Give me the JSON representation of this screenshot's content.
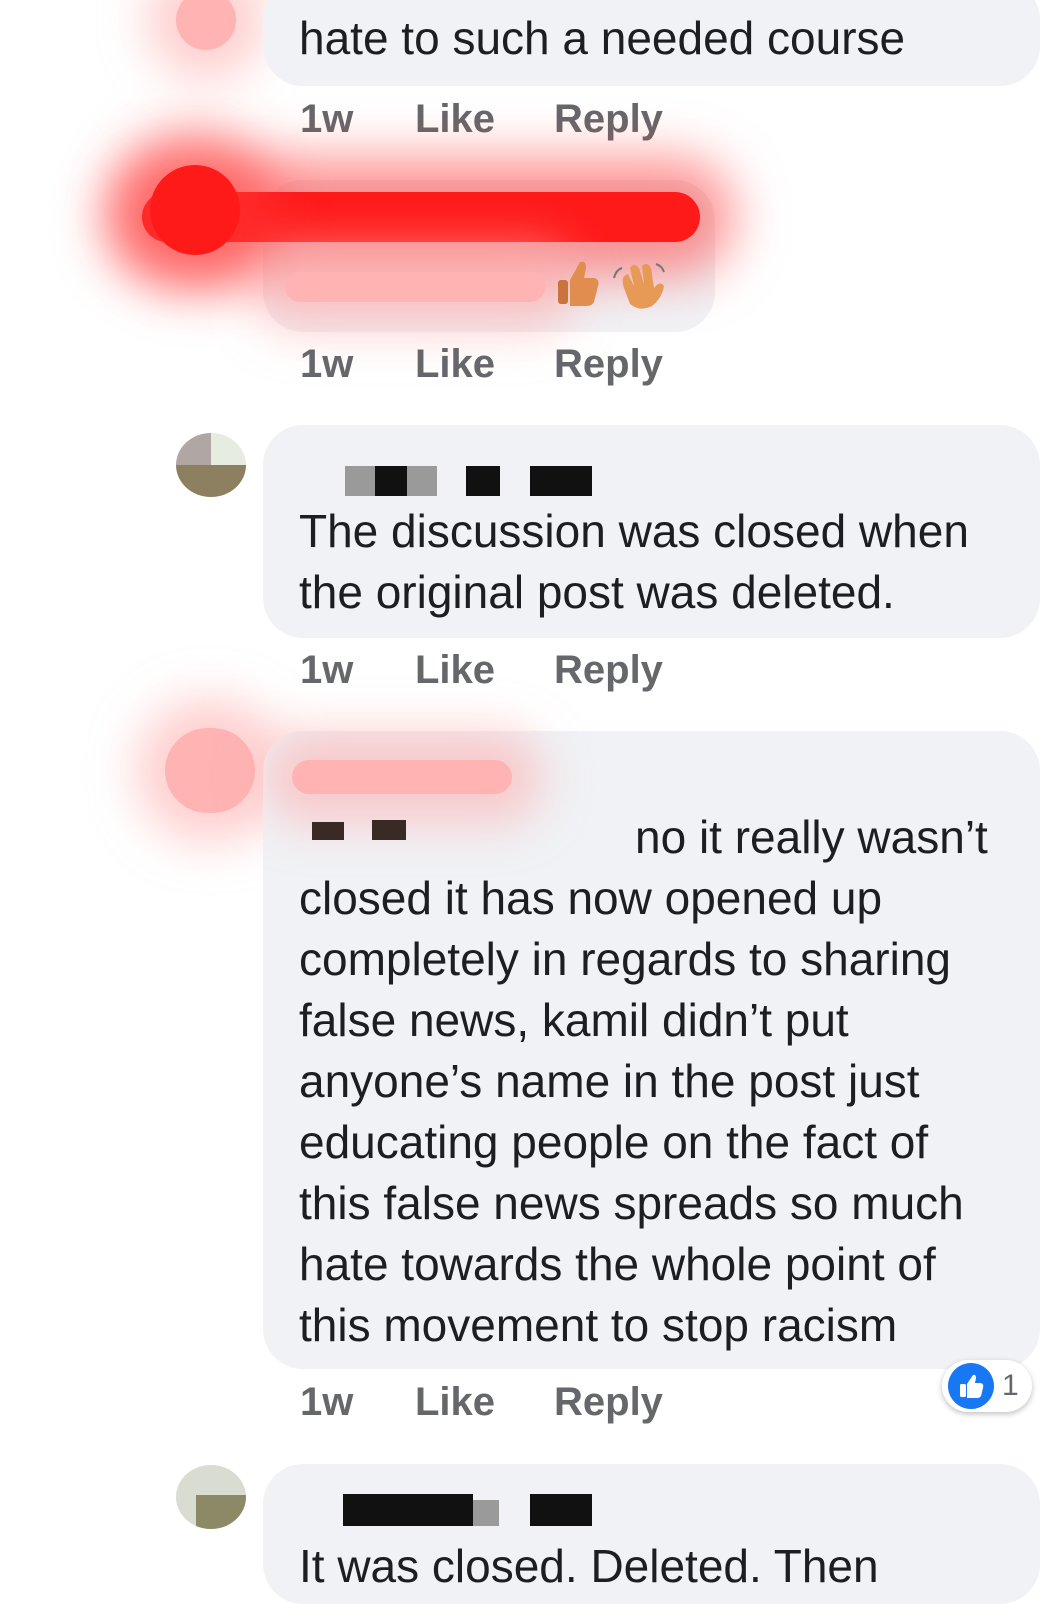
{
  "comments": [
    {
      "text": "hate to such a needed course",
      "time": "1w",
      "like_label": "Like",
      "reply_label": "Reply"
    },
    {
      "text": "",
      "time": "1w",
      "like_label": "Like",
      "reply_label": "Reply",
      "emojis": [
        "thumbs-up-icon",
        "waving-hand-icon"
      ]
    },
    {
      "text_lines": [
        "The discussion was closed when",
        "the original post was deleted."
      ],
      "time": "1w",
      "like_label": "Like",
      "reply_label": "Reply"
    },
    {
      "text_lines": [
        "no it really wasn’t",
        "closed it has now opened up",
        "completely in regards to sharing",
        "false news, kamil didn’t put",
        "anyone’s name in the post just",
        "educating people on the fact of",
        "this false news spreads so much",
        "hate towards the whole point of",
        "this movement to stop racism"
      ],
      "time": "1w",
      "like_label": "Like",
      "reply_label": "Reply",
      "reaction_count": "1"
    },
    {
      "text": "It was closed. Deleted. Then"
    }
  ],
  "colors": {
    "bubble": "#f0f2f5",
    "meta": "#65676b",
    "like_blue": "#1877f2",
    "redaction": "#ff1a1a"
  }
}
